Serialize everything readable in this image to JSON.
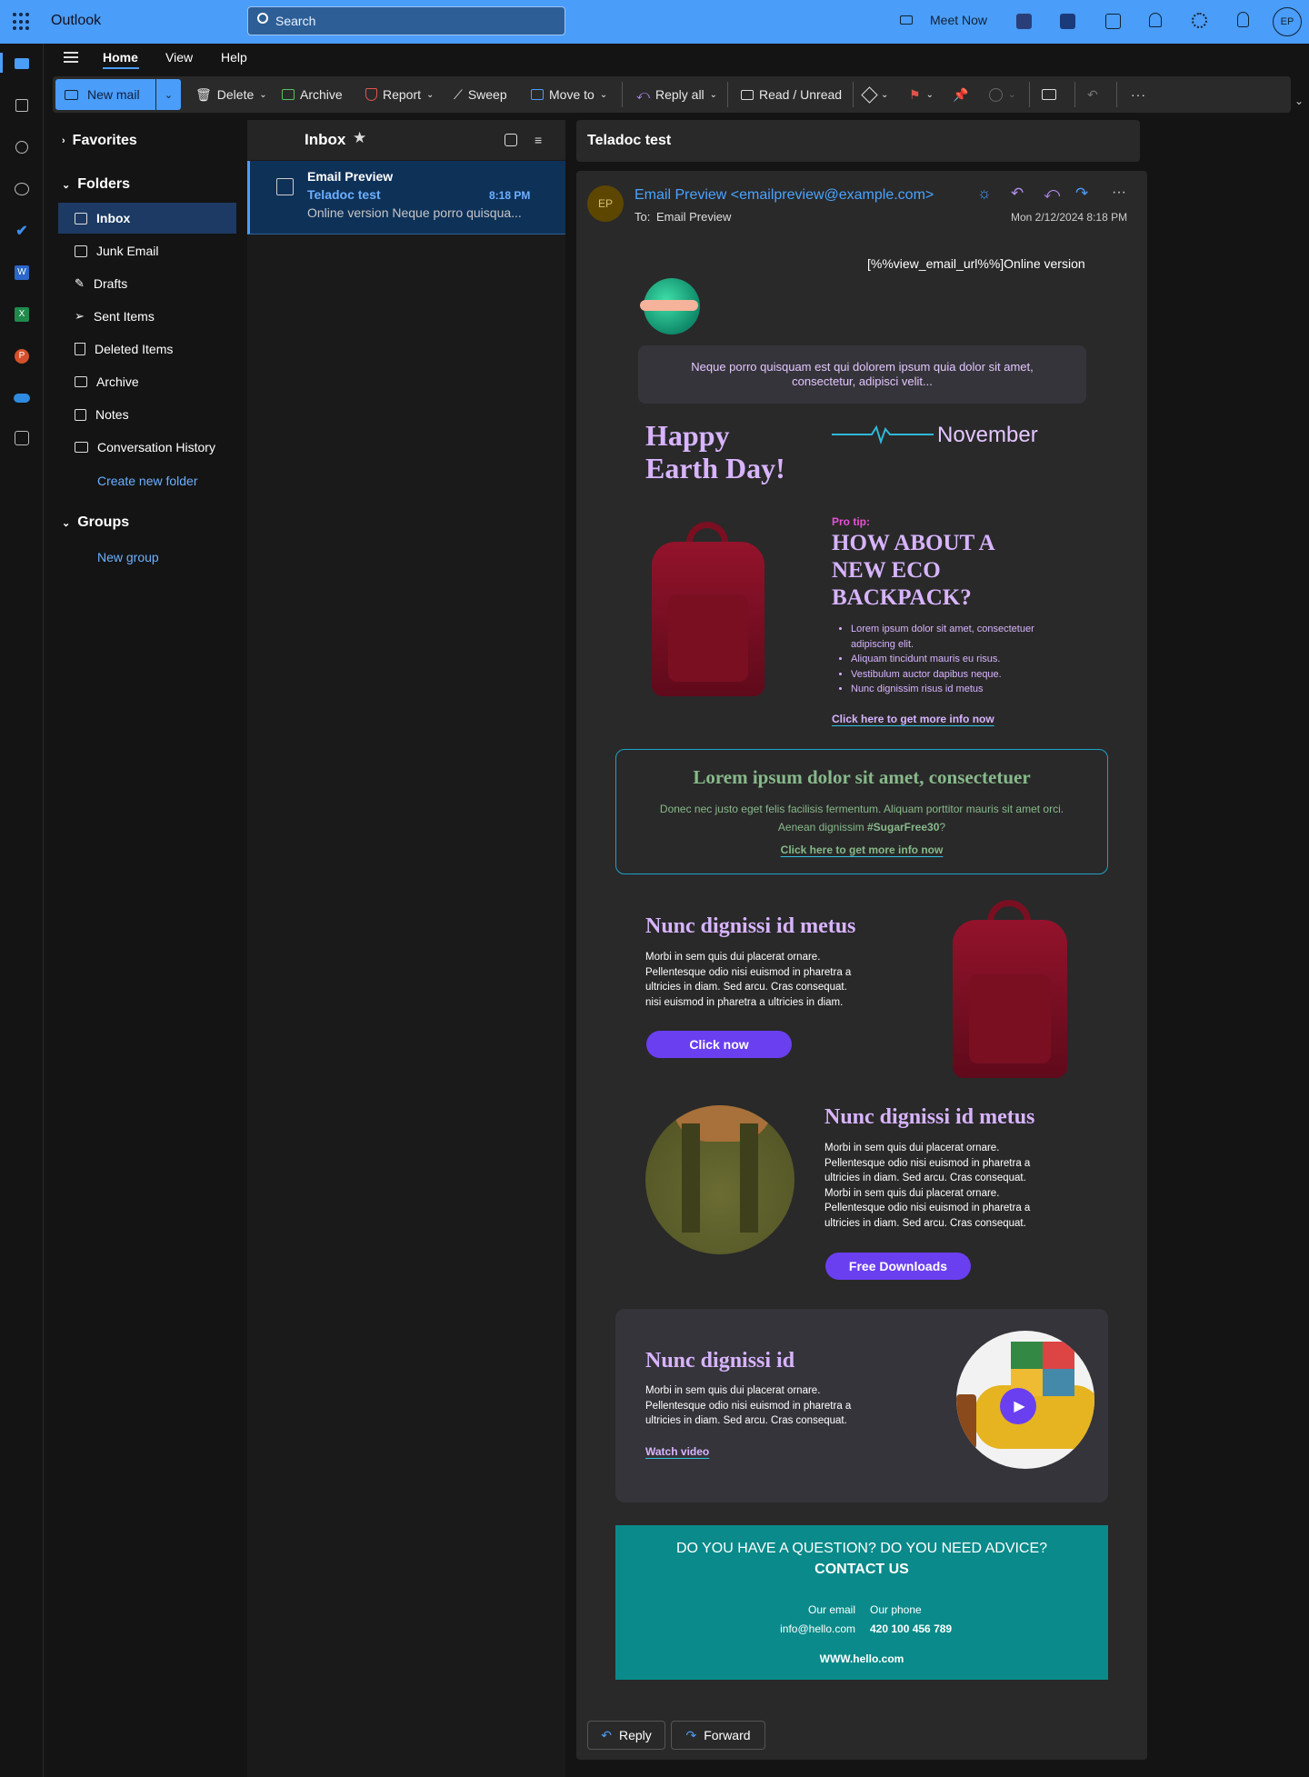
{
  "app": {
    "title": "Outlook",
    "search_placeholder": "Search",
    "meet_now": "Meet Now",
    "avatar": "EP"
  },
  "tabs": [
    "Home",
    "View",
    "Help"
  ],
  "ribbon": {
    "new_mail": "New mail",
    "delete": "Delete",
    "archive": "Archive",
    "report": "Report",
    "sweep": "Sweep",
    "move_to": "Move to",
    "reply_all": "Reply all",
    "read_unread": "Read / Unread"
  },
  "nav": {
    "favorites": "Favorites",
    "folders": "Folders",
    "items": [
      "Inbox",
      "Junk Email",
      "Drafts",
      "Sent Items",
      "Deleted Items",
      "Archive",
      "Notes",
      "Conversation History"
    ],
    "create_folder": "Create new folder",
    "groups": "Groups",
    "new_group": "New group"
  },
  "list": {
    "title": "Inbox",
    "item": {
      "sender": "Email Preview",
      "subject": "Teladoc test",
      "time": "8:18 PM",
      "preview": "Online version Neque porro quisqua..."
    }
  },
  "reading": {
    "subject": "Teladoc test",
    "from": "Email Preview <emailpreview@example.com>",
    "to_label": "To:",
    "to": "Email Preview",
    "date": "Mon 2/12/2024 8:18 PM",
    "initials": "EP",
    "reply": "Reply",
    "forward": "Forward"
  },
  "email": {
    "online_version": "[%%view_email_url%%]Online version",
    "preheader": "Neque porro quisquam est qui dolorem ipsum quia dolor sit amet, consectetur, adipisci velit...",
    "headline_line1": "Happy",
    "headline_line2": "Earth Day!",
    "month": "November",
    "pro_tip": "Pro tip:",
    "backpack_title_1": "HOW ABOUT A",
    "backpack_title_2": "NEW ECO",
    "backpack_title_3": "BACKPACK?",
    "bullets": [
      "Lorem ipsum dolor sit amet, consectetuer adipiscing elit.",
      "Aliquam tincidunt mauris eu risus.",
      "Vestibulum auctor dapibus neque.",
      "Nunc dignissim risus id metus"
    ],
    "info_link": "Click here to get more info now",
    "box_title": "Lorem ipsum dolor sit amet, consectetuer",
    "box_text_1": "Donec nec justo eget felis facilisis fermentum. Aliquam porttitor mauris sit amet orci.",
    "box_text_2a": "Aenean dignissim ",
    "box_text_2b": "#SugarFree30",
    "box_text_2c": "?",
    "box_link": "Click here to get more info now",
    "sec1_title": "Nunc dignissi id metus",
    "sec1_text": "Morbi in sem quis dui placerat ornare. Pellentesque odio nisi euismod in pharetra a ultricies in diam. Sed arcu. Cras consequat. nisi euismod in pharetra a ultricies in diam.",
    "sec1_button": "Click now",
    "sec2_title": "Nunc dignissi id metus",
    "sec2_text": "Morbi in sem quis dui placerat ornare. Pellentesque odio nisi euismod in pharetra a ultricies in diam. Sed arcu. Cras consequat. Morbi in sem quis dui placerat ornare. Pellentesque odio nisi euismod in pharetra a ultricies in diam. Sed arcu. Cras consequat.",
    "sec2_button": "Free Downloads",
    "sec3_title": "Nunc dignissi id",
    "sec3_text": "Morbi in sem quis dui placerat ornare. Pellentesque odio nisi euismod in pharetra a ultricies in diam. Sed arcu. Cras consequat.",
    "sec3_link": "Watch video",
    "contact_q": "DO YOU HAVE A QUESTION? DO YOU NEED ADVICE?",
    "contact_title": "CONTACT US",
    "email_label": "Our email",
    "email_value": "info@hello.com",
    "phone_label": "Our phone",
    "phone_value": "420 100 456 789",
    "website": "WWW.hello.com"
  },
  "colors": {
    "topbar": "#4a9df8",
    "accent_purple": "#6a3ff0",
    "teal": "#0a8a8a",
    "pink": "#d8b4ff"
  }
}
